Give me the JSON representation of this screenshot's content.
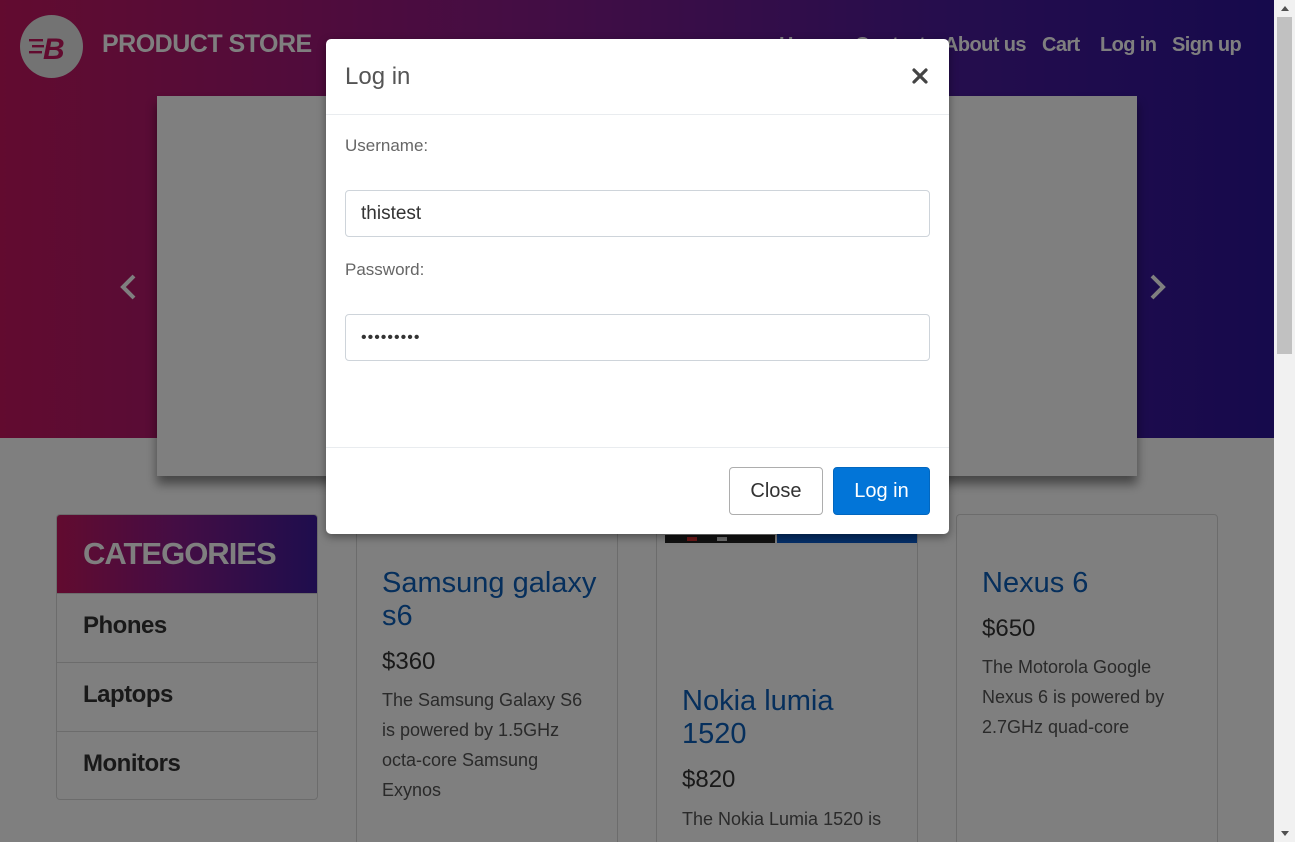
{
  "brand": {
    "name": "PRODUCT STORE"
  },
  "nav": {
    "items": [
      "Home",
      "Contact",
      "About us",
      "Cart",
      "Log in",
      "Sign up"
    ]
  },
  "categories": {
    "title": "CATEGORIES",
    "items": [
      "Phones",
      "Laptops",
      "Monitors"
    ]
  },
  "products": [
    {
      "title": "Samsung galaxy s6",
      "price": "$360",
      "desc": "The Samsung Galaxy S6 is powered by 1.5GHz octa-core Samsung Exynos"
    },
    {
      "title": "Nokia lumia 1520",
      "price": "$820",
      "desc": "The Nokia Lumia 1520 is"
    },
    {
      "title": "Nexus 6",
      "price": "$650",
      "desc": "The Motorola Google Nexus 6 is powered by 2.7GHz quad-core"
    }
  ],
  "modal": {
    "title": "Log in",
    "username_label": "Username:",
    "username_value": "thistest",
    "password_label": "Password:",
    "password_value": "•••••••••",
    "close_label": "Close",
    "login_label": "Log in"
  },
  "icons": {
    "logo": "bolt-b-logo-icon",
    "prev": "chevron-left-icon",
    "next": "chevron-right-icon",
    "close": "close-icon"
  },
  "colors": {
    "primary_button": "#0275d8",
    "link": "#0d5fb8",
    "hero_start": "#c4175f",
    "hero_end": "#2c1499"
  }
}
